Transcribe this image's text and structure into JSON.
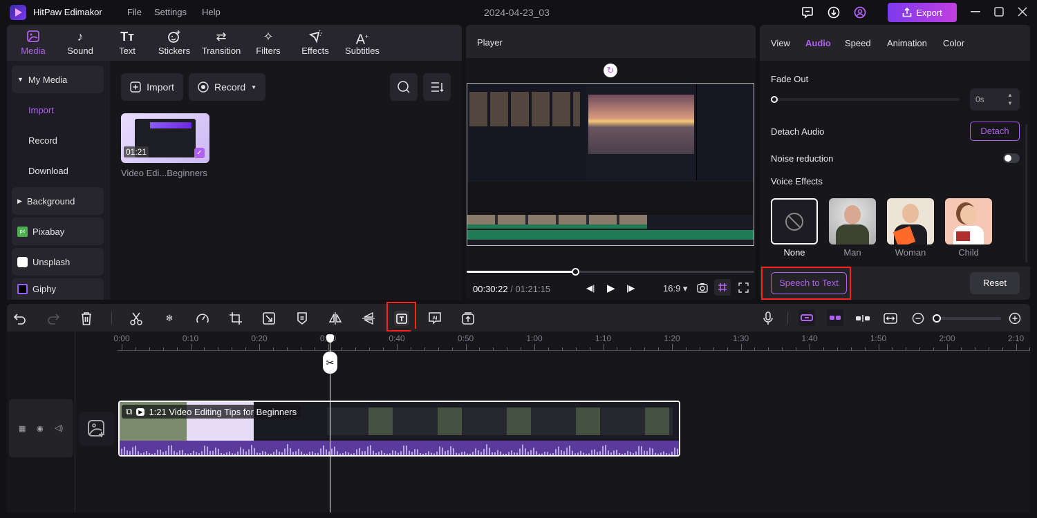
{
  "app": {
    "name": "HitPaw Edimakor",
    "document_title": "2024-04-23_03"
  },
  "menu": [
    "File",
    "Settings",
    "Help"
  ],
  "titlebar": {
    "export_label": "Export",
    "icons": [
      "feedback-icon",
      "download-icon",
      "account-icon"
    ]
  },
  "media_tabs": [
    {
      "label": "Media",
      "icon": "media-icon",
      "active": true
    },
    {
      "label": "Sound",
      "icon": "music-note-icon"
    },
    {
      "label": "Text",
      "icon": "text-icon"
    },
    {
      "label": "Stickers",
      "icon": "sticker-icon"
    },
    {
      "label": "Transition",
      "icon": "transition-icon"
    },
    {
      "label": "Filters",
      "icon": "sparkle-icon"
    },
    {
      "label": "Effects",
      "icon": "effects-icon"
    },
    {
      "label": "Subtitles",
      "icon": "subtitles-icon"
    }
  ],
  "sidebar": {
    "my_media": "My Media",
    "sub_items": [
      {
        "label": "Import",
        "active": true
      },
      {
        "label": "Record"
      },
      {
        "label": "Download"
      }
    ],
    "background": "Background",
    "sources": [
      "Pixabay",
      "Unsplash",
      "Giphy"
    ]
  },
  "media": {
    "import_label": "Import",
    "record_label": "Record",
    "items": [
      {
        "name": "Video Edi...Beginners",
        "duration": "01:21",
        "selected": true
      }
    ]
  },
  "player": {
    "title": "Player",
    "current_time": "00:30:22",
    "total_time": "01:21:15",
    "separator": "/",
    "aspect_ratio": "16:9",
    "progress": 0.38
  },
  "properties": {
    "tabs": [
      {
        "label": "View"
      },
      {
        "label": "Audio",
        "active": true
      },
      {
        "label": "Speed"
      },
      {
        "label": "Animation"
      },
      {
        "label": "Color"
      }
    ],
    "fade_out_label": "Fade Out",
    "fade_out_value": "0s",
    "fade_out_level": 0,
    "detach_audio_label": "Detach Audio",
    "detach_button": "Detach",
    "noise_reduction_label": "Noise reduction",
    "noise_reduction_on": false,
    "voice_effects_label": "Voice Effects",
    "voice_effects": [
      {
        "label": "None",
        "selected": true
      },
      {
        "label": "Man"
      },
      {
        "label": "Woman"
      },
      {
        "label": "Child"
      }
    ],
    "speech_to_text_button": "Speech to Text",
    "reset_button": "Reset"
  },
  "toolbar": {
    "tooltip": "Speech to Text",
    "tools": [
      "undo",
      "redo",
      "delete",
      "split",
      "freeze",
      "speed",
      "crop",
      "resize",
      "mask",
      "mirror",
      "flip",
      "speech-to-text",
      "ai-caption",
      "export-clip"
    ],
    "zoom_level": 0.05
  },
  "timeline": {
    "ruler_labels": [
      "0:00",
      "0:10",
      "0:20",
      "0:30",
      "0:40",
      "0:50",
      "1:00",
      "1:10",
      "1:20",
      "1:30",
      "1:40",
      "1:50",
      "2:00",
      "2:10"
    ],
    "clip_title": "1:21 Video Editing Tips for Beginners"
  },
  "colors": {
    "accent": "#b061f0",
    "export_start": "#7c3aed",
    "export_end": "#c13fe0",
    "audio_track": "#5a3a9a",
    "highlight": "#ff2020"
  }
}
